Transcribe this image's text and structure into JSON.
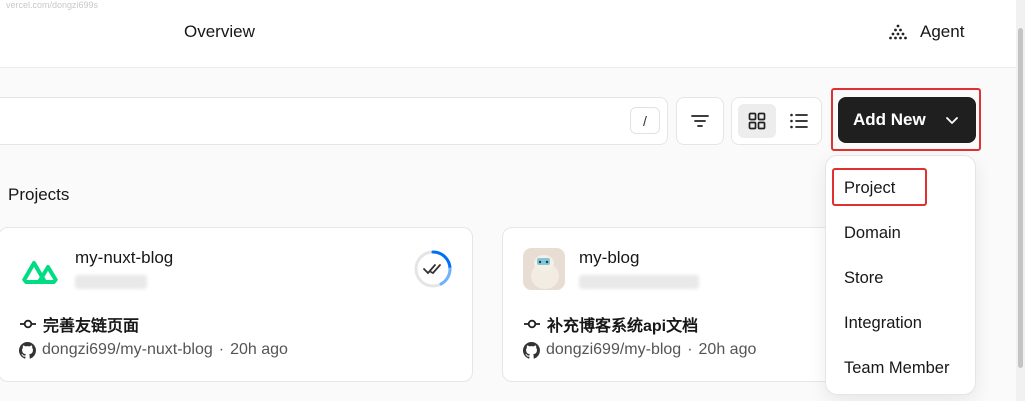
{
  "header": {
    "url_ghost": "vercel.com/dongzi699s",
    "title": "Overview",
    "agent_label": "Agent",
    "agent_icon": "agent-triangle-icon"
  },
  "toolbar": {
    "search_placeholder": "",
    "shortcut_key": "/",
    "filter_icon": "filter-icon",
    "view_grid_icon": "grid-view-icon",
    "view_list_icon": "list-view-icon",
    "add_new_label": "Add New",
    "add_new_icon": "chevron-down-icon"
  },
  "projects": {
    "section_title": "Projects",
    "items": [
      {
        "name": "my-nuxt-blog",
        "commit_message": "完善友链页面",
        "repo": "dongzi699/my-nuxt-blog",
        "separator": "·",
        "time": "20h ago"
      },
      {
        "name": "my-blog",
        "commit_message": "补充博客系统api文档",
        "repo": "dongzi699/my-blog",
        "separator": "·",
        "time": "20h ago"
      }
    ]
  },
  "dropdown": {
    "items": [
      "Project",
      "Domain",
      "Store",
      "Integration",
      "Team Member"
    ]
  },
  "colors": {
    "highlight": "#e03131",
    "primary_button": "#1f1f1f",
    "nuxt_green": "#00dc82"
  }
}
